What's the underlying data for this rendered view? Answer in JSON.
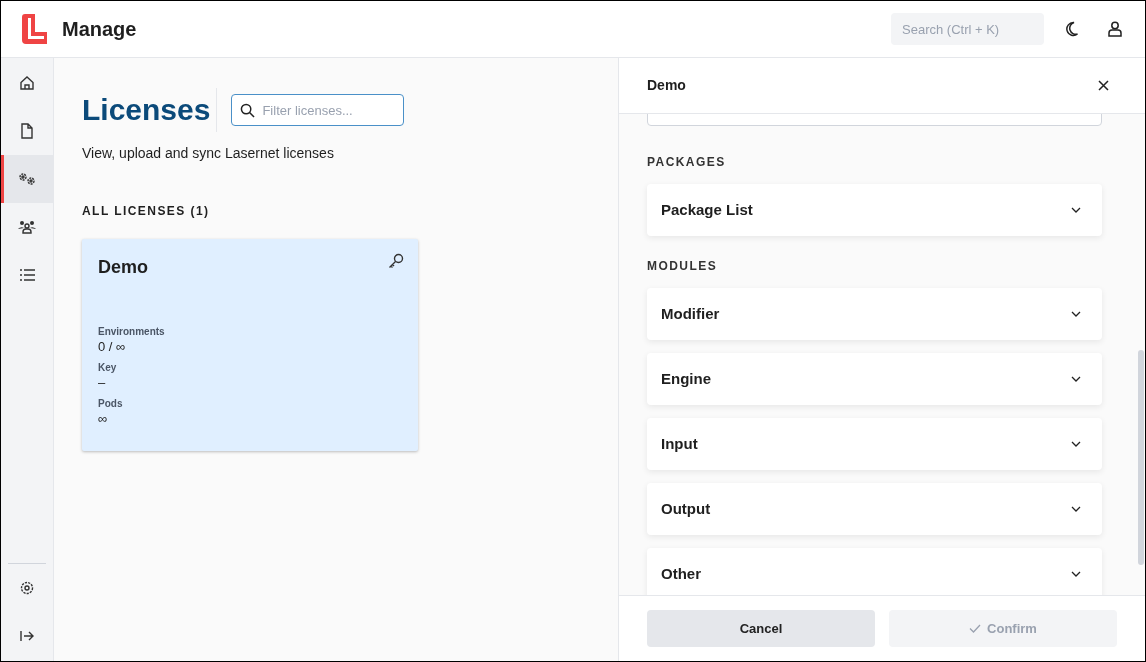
{
  "app": {
    "title": "Manage",
    "search_placeholder": "Search (Ctrl + K)"
  },
  "nav": [
    {
      "selected": false
    },
    {
      "selected": false
    },
    {
      "selected": true
    },
    {
      "selected": false
    },
    {
      "selected": false
    }
  ],
  "page": {
    "title": "Licenses",
    "filter_placeholder": "Filter licenses...",
    "subtitle": "View, upload and sync Lasernet licenses",
    "section": "ALL LICENSES (1)"
  },
  "licenses": [
    {
      "name": "Demo",
      "fields": [
        {
          "label": "Environments",
          "value": "0 / ∞"
        },
        {
          "label": "Key",
          "value": "–"
        },
        {
          "label": "Pods",
          "value": "∞"
        }
      ]
    }
  ],
  "panel": {
    "title": "Demo",
    "sections": [
      {
        "heading": "PACKAGES",
        "items": [
          {
            "label": "Package List",
            "expanded": false
          }
        ]
      },
      {
        "heading": "MODULES",
        "items": [
          {
            "label": "Modifier",
            "expanded": false
          },
          {
            "label": "Engine",
            "expanded": false
          },
          {
            "label": "Input",
            "expanded": false
          },
          {
            "label": "Output",
            "expanded": false
          },
          {
            "label": "Other",
            "expanded": false
          }
        ]
      }
    ],
    "buttons": [
      {
        "label": "Cancel",
        "disabled": false
      },
      {
        "label": "Confirm",
        "disabled": true
      }
    ]
  }
}
